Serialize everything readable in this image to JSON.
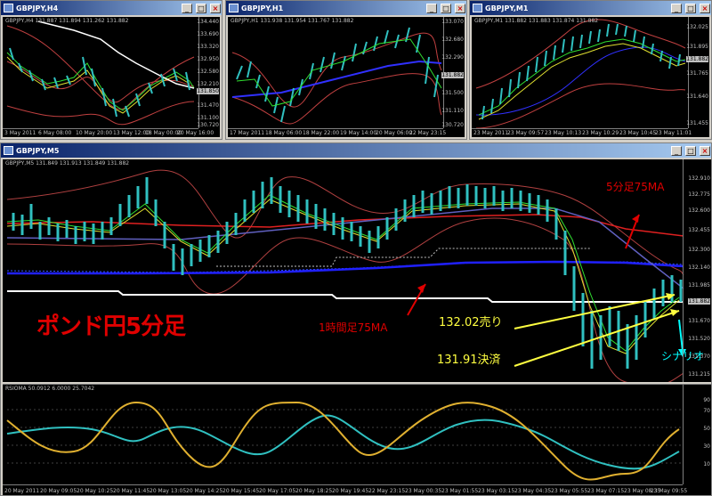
{
  "windows": {
    "h4": {
      "title": "GBPJPY,H4",
      "info": "GBPJPY,H4  131.887 131.894 131.262 131.882",
      "prices": [
        "134.440",
        "133.690",
        "133.320",
        "132.950",
        "132.580",
        "132.210",
        "131.850",
        "131.470",
        "131.100",
        "130.720"
      ],
      "times": [
        "3 May 2011",
        "6 May 08:00",
        "10 May 20:00",
        "13 May 12:00",
        "18 May 00:00",
        "20 May 16:00"
      ],
      "last_price": "131.882"
    },
    "h1": {
      "title": "GBPJPY,H1",
      "info": "GBPJPY,H1  131.938 131.954 131.767 131.882",
      "prices": [
        "133.070",
        "132.680",
        "132.290",
        "131.882",
        "131.500",
        "131.110",
        "130.720"
      ],
      "times": [
        "17 May 2011",
        "18 May 06:00",
        "18 May 22:00",
        "19 May 14:00",
        "20 May 06:00",
        "22 May 23:15"
      ],
      "last_price": "131.882"
    },
    "m1": {
      "title": "GBPJPY,M1",
      "info": "GBPJPY,M1  131.882 131.883 131.874 131.882",
      "prices": [
        "132.025",
        "131.895",
        "131.882",
        "131.765",
        "131.640",
        "131.455"
      ],
      "times": [
        "23 May 2011",
        "23 May 09:57",
        "23 May 10:13",
        "23 May 10:29",
        "23 May 10:45",
        "23 May 11:01"
      ],
      "last_price": "131.882"
    },
    "m5": {
      "title": "GBPJPY,M5",
      "info": "GBPJPY,M5  131.849 131.913 131.849 131.882",
      "prices": [
        "132.910",
        "132.775",
        "132.600",
        "132.455",
        "132.300",
        "132.140",
        "131.985",
        "131.882",
        "131.670",
        "131.520",
        "131.370",
        "131.215"
      ],
      "times": [
        "20 May 2011",
        "20 May 09:05",
        "20 May 10:25",
        "20 May 11:45",
        "20 May 13:05",
        "20 May 14:25",
        "20 May 15:45",
        "20 May 17:05",
        "20 May 18:25",
        "20 May 19:45",
        "22 May 23:15",
        "23 May 00:35",
        "23 May 01:55",
        "23 May 03:15",
        "23 May 04:35",
        "23 May 05:55",
        "23 May 07:15",
        "23 May 08:35",
        "23 May 09:55"
      ],
      "last_price": "131.882",
      "rsi": {
        "info": "RSIOMA 50.0912 6.0000 25.7042",
        "levels": [
          "90",
          "70",
          "50",
          "30",
          "10"
        ]
      }
    }
  },
  "annotations": {
    "m5_75ma": "5分足75MA",
    "h1_75ma": "1時間足75MA",
    "title": "ポンド円5分足",
    "sell": "132.02売り",
    "settle": "131.91決済",
    "scenario": "シナリオ"
  },
  "colors": {
    "titlebar": "#0a246a",
    "chart_bg": "#000000",
    "ann_red": "#e00000",
    "ann_yellow": "#ffff40",
    "ann_cyan": "#00ffff"
  }
}
